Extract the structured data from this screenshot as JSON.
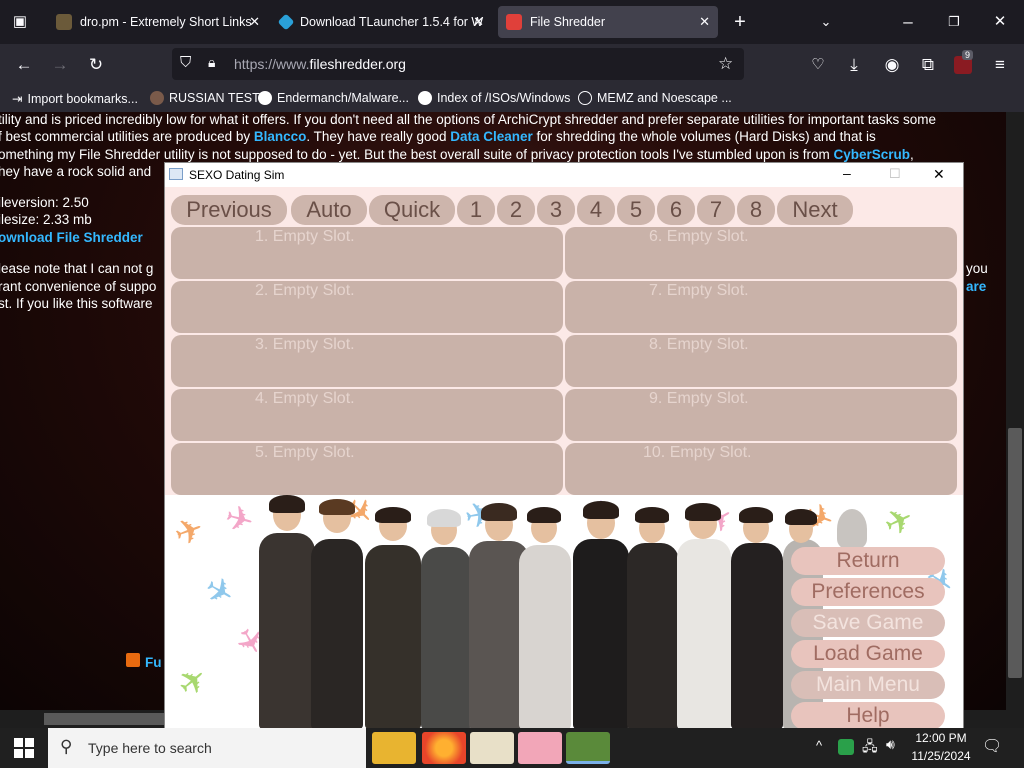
{
  "browser": {
    "tabs": [
      {
        "title": "dro.pm - Extremely Short Links",
        "active": false,
        "fav_color": "#6b5a3a"
      },
      {
        "title": "Download TLauncher 1.5.4 for W",
        "active": false,
        "fav_color": "#2aa0d8"
      },
      {
        "title": "File Shredder",
        "active": true,
        "fav_color": "#e0403a"
      }
    ],
    "url": {
      "prefix": "https://www.",
      "domain": "fileshredder.org"
    },
    "extension_badge": "9",
    "bookmarks": [
      "Import bookmarks...",
      "RUSSIAN TEST",
      "Endermanch/Malware...",
      "Index of /ISOs/Windows",
      "MEMZ and Noescape ..."
    ]
  },
  "page": {
    "line1": "tility and is priced incredibly low for what it offers. If you don't need all the options of ArchiCrypt shredder and prefer separate utilities for important tasks some",
    "line2_a": "f best commercial utilities are produced by ",
    "line2_link1": "Blancco",
    "line2_b": ". They have really good ",
    "line2_link2": "Data Cleaner",
    "line2_c": " for shredding the whole volumes (Hard Disks) and that is",
    "line3_a": "omething my File Shredder utility is not supposed to do - yet. But the best overall suite of privacy protection tools I've stumbled upon is from ",
    "line3_link": "CyberScrub",
    "line3_b": ",",
    "line4": "hey have a rock solid and",
    "fileversion": "ileversion: 2.50",
    "filesize": "ilesize: 2.33 mb",
    "download_link": "ownload File Shredder",
    "note1": "lease note that I can not g",
    "note1_right": "you",
    "note2": "rant convenience of suppo",
    "note2_right": "are",
    "note3": "st. If you like this software",
    "footer_link": "Fu"
  },
  "app": {
    "title": "SEXO Dating Sim",
    "nav": [
      "Previous",
      "Auto",
      "Quick",
      "1",
      "2",
      "3",
      "4",
      "5",
      "6",
      "7",
      "8",
      "Next"
    ],
    "slots": [
      "1. Empty Slot.",
      "6. Empty Slot.",
      "2. Empty Slot.",
      "7. Empty Slot.",
      "3. Empty Slot.",
      "8. Empty Slot.",
      "4. Empty Slot.",
      "9. Empty Slot.",
      "5. Empty Slot.",
      "10. Empty Slot."
    ],
    "menu": [
      {
        "label": "Return",
        "enabled": true
      },
      {
        "label": "Preferences",
        "enabled": true
      },
      {
        "label": "Save Game",
        "enabled": false
      },
      {
        "label": "Load Game",
        "enabled": true
      },
      {
        "label": "Main Menu",
        "enabled": false
      },
      {
        "label": "Help",
        "enabled": true
      }
    ]
  },
  "taskbar": {
    "search_placeholder": "Type here to search",
    "time": "12:00 PM",
    "date": "11/25/2024"
  }
}
